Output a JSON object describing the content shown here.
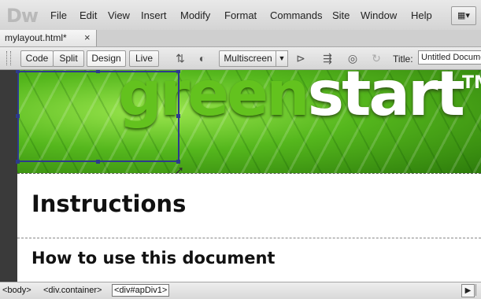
{
  "app": {
    "logo": "Dw"
  },
  "menu": [
    "File",
    "Edit",
    "View",
    "Insert",
    "Modify",
    "Format",
    "Commands",
    "Site",
    "Window",
    "Help"
  ],
  "layout_button": {
    "icon": "▦▾"
  },
  "tab": {
    "label": "mylayout.html*",
    "close": "×"
  },
  "toolbar": {
    "view_buttons": [
      "Code",
      "Split",
      "Design",
      "Live"
    ],
    "active_view": "Design",
    "multiscreen": "Multiscreen",
    "dropdown_icon": "▼",
    "title_label": "Title:",
    "title_value": "Untitled Document"
  },
  "icons": {
    "live_code": "⇅",
    "globe": "◐",
    "inspect": "⊳",
    "file_mgmt": "⇶",
    "preview": "◎",
    "refresh": "↻"
  },
  "banner": {
    "green": "green",
    "start": "start",
    "tm": "TM"
  },
  "content": {
    "heading1": "Instructions",
    "heading2": "How to use this document"
  },
  "statusbar": {
    "tags": [
      "<body>",
      "<div.container>",
      "<div#apDiv1>"
    ],
    "select_icon": "▶"
  }
}
